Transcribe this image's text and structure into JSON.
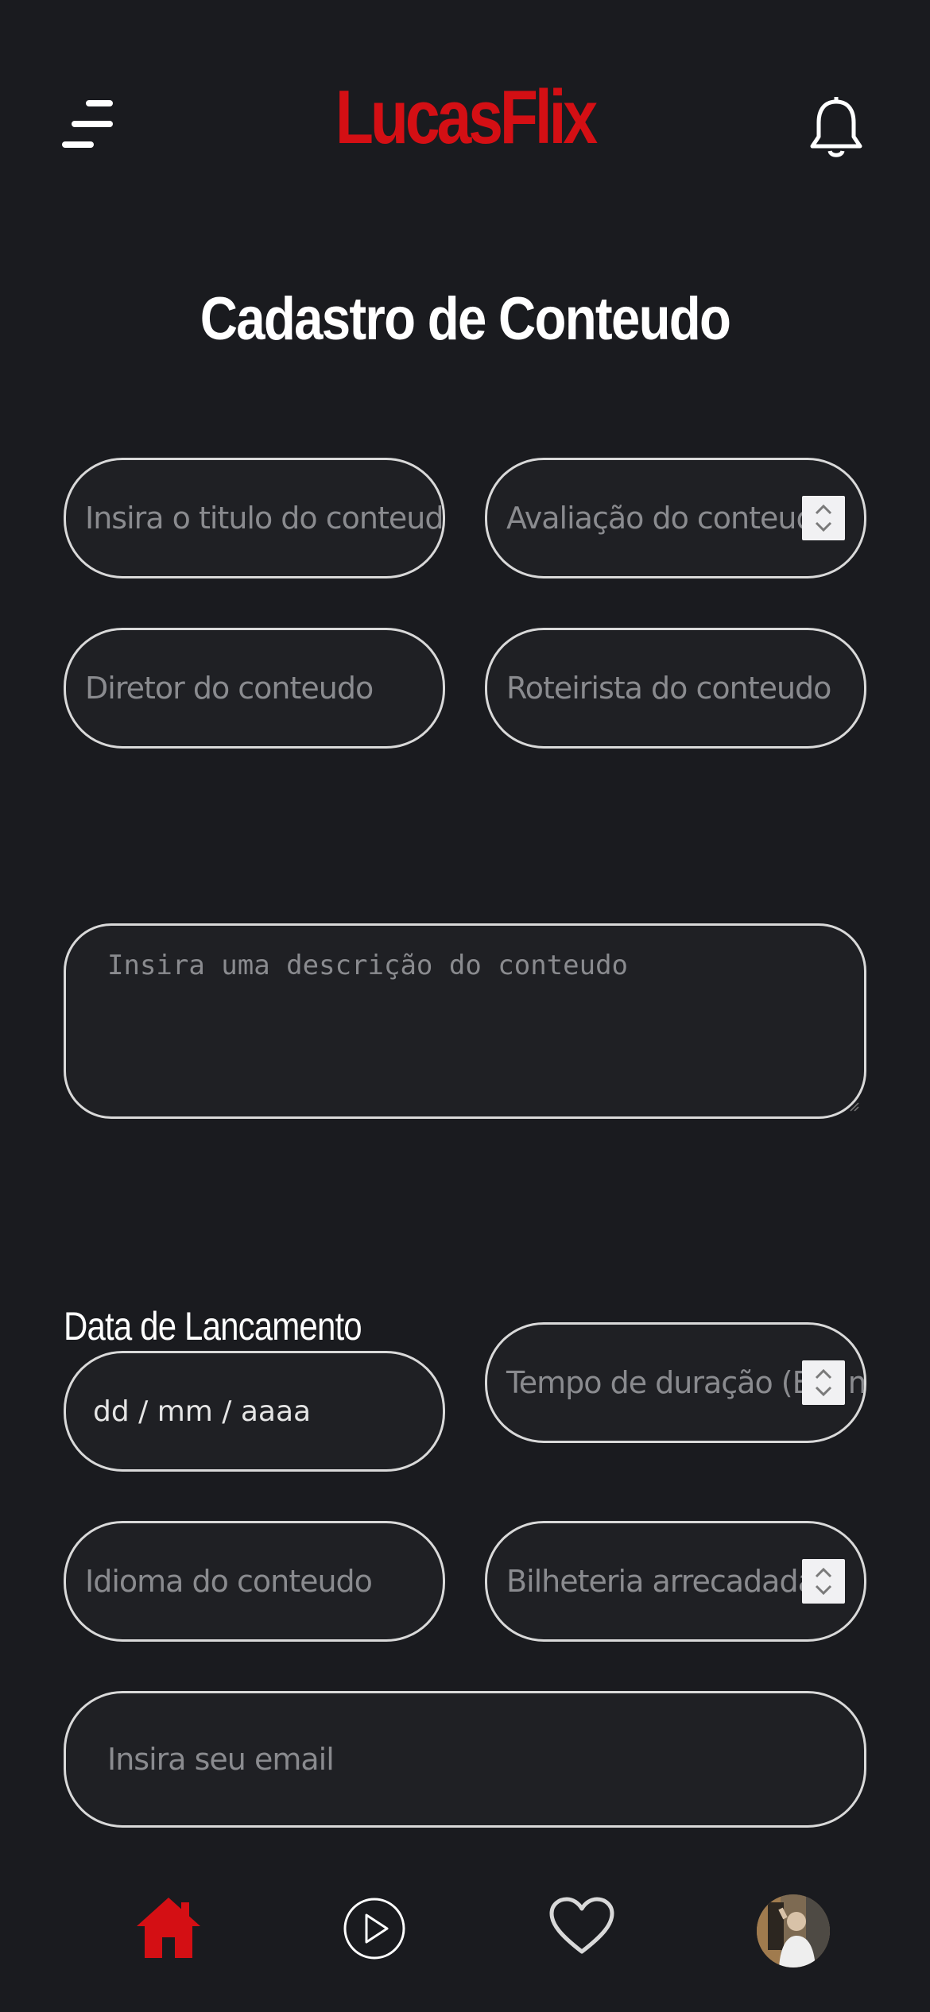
{
  "header": {
    "brand": "LucasFlix",
    "menu_icon": "menu-icon",
    "notification_icon": "bell-icon"
  },
  "page_title": "Cadastro de Conteudo",
  "form": {
    "title_placeholder": "Insira o titulo do conteudo",
    "rating_placeholder": "Avaliação do conteudo",
    "director_placeholder": "Diretor do conteudo",
    "writer_placeholder": "Roteirista do conteudo",
    "description_placeholder": "Insira uma descrição do conteudo",
    "release_date_label": "Data de Lancamento",
    "release_date_value": "dd / mm / aaaa",
    "duration_placeholder": "Tempo de duração (Em minutos)",
    "language_placeholder": "Idioma do conteudo",
    "box_office_placeholder": "Bilheteria arrecadada",
    "email_placeholder": "Insira seu email"
  },
  "nav": {
    "items": [
      "home-icon",
      "play-icon",
      "heart-icon",
      "avatar"
    ],
    "active": "home-icon"
  },
  "colors": {
    "background": "#1a1b1f",
    "brand": "#d40f14",
    "field_border": "#d9d9d9",
    "placeholder": "#8a8b8f"
  }
}
